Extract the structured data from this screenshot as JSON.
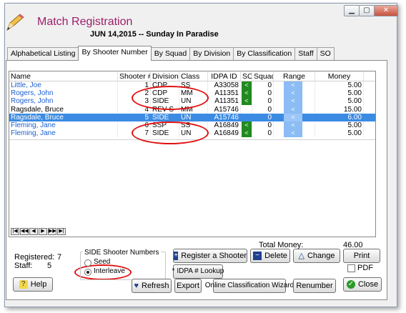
{
  "window": {
    "title": "Match Registration",
    "controls": {
      "minimize": "▁",
      "maximize": "▢",
      "close": "✕"
    }
  },
  "event": {
    "line": "JUN 14,2015 -- Sunday In Paradise"
  },
  "tabs": [
    {
      "label": "Alphabetical Listing"
    },
    {
      "label": "By Shooter Number",
      "active": true
    },
    {
      "label": "By Squad"
    },
    {
      "label": "By Division"
    },
    {
      "label": "By Classification"
    },
    {
      "label": "Staff"
    },
    {
      "label": "SO"
    }
  ],
  "table": {
    "headers": {
      "name": "Name",
      "number": "Shooter #",
      "division": "Division",
      "class": "Class",
      "idpa": "IDPA ID",
      "so": "SO",
      "squad": "Squad",
      "range": "Range",
      "money": "Money"
    },
    "rows": [
      {
        "name": "Little, Joe",
        "number": "1",
        "division": "CDP",
        "class": "SS",
        "idpa": "A33058",
        "so": "<",
        "squad": "0",
        "range": "<",
        "money": "5.00"
      },
      {
        "name": "Rogers, John",
        "number": "2",
        "division": "CDP",
        "class": "MM",
        "idpa": "A11351",
        "so": "<",
        "squad": "0",
        "range": "<",
        "money": "5.00"
      },
      {
        "name": "Rogers, John",
        "number": "3",
        "division": "SIDE",
        "class": "UN",
        "idpa": "A11351",
        "so": "<",
        "squad": "0",
        "range": "<",
        "money": "5.00"
      },
      {
        "name": "Ragsdale, Bruce",
        "number": "4",
        "division": "REV-S",
        "class": "MM",
        "idpa": "A15746",
        "so": "",
        "squad": "0",
        "range": "<",
        "money": "15.00"
      },
      {
        "name": "Ragsdale, Bruce",
        "number": "5",
        "division": "SIDE",
        "class": "UN",
        "idpa": "A15746",
        "so": "",
        "squad": "0",
        "range": "<",
        "money": "6.00"
      },
      {
        "name": "Fleming, Jane",
        "number": "6",
        "division": "SSP",
        "class": "SS",
        "idpa": "A16849",
        "so": "<",
        "squad": "0",
        "range": "<",
        "money": "5.00"
      },
      {
        "name": "Fleming, Jane",
        "number": "7",
        "division": "SIDE",
        "class": "UN",
        "idpa": "A16849",
        "so": "<",
        "squad": "0",
        "range": "<",
        "money": "5.00"
      }
    ],
    "nav": [
      "|◀",
      "◀◀",
      "◀",
      "▶",
      "▶▶",
      "▶|"
    ]
  },
  "totals": {
    "label": "Total Money:",
    "value": "46.00"
  },
  "stats": {
    "registered_label": "Registered:",
    "registered_value": "7",
    "staff_label": "Staff:",
    "staff_value": "5"
  },
  "side_numbers": {
    "title": "SIDE Shooter Numbers",
    "options": [
      {
        "label": "Seed",
        "selected": false
      },
      {
        "label": "Interleave",
        "selected": true
      }
    ]
  },
  "buttons": {
    "register": "Register a Shooter",
    "delete": "Delete",
    "change": "Change",
    "print": "Print",
    "idpa_lookup": "* IDPA # Lookup",
    "pdf": "PDF",
    "help": "Help",
    "refresh": "Refresh",
    "export": "Export",
    "wizard": "Online Classification Wizard",
    "renumber": "Renumber",
    "close": "Close"
  },
  "colors": {
    "title": "#9c1e6b",
    "name_link": "#1a5fcf",
    "selection": "#3b8be3",
    "so_flag": "#1f8a1f",
    "range": "#8bbcf4",
    "annotation": "#e01010"
  }
}
